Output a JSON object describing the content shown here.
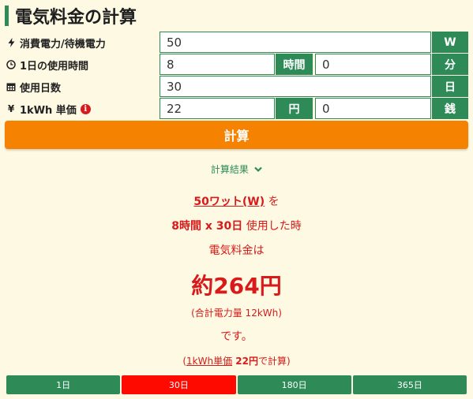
{
  "title": "電気料金の計算",
  "form": {
    "power": {
      "icon": "bolt-icon",
      "label": "消費電力/待機電力",
      "value": "50",
      "unit": "W"
    },
    "hours": {
      "icon": "clock-icon",
      "label": "1日の使用時間",
      "hours_value": "8",
      "hours_unit": "時間",
      "minutes_value": "0",
      "minutes_unit": "分"
    },
    "days": {
      "icon": "calendar-icon",
      "label": "使用日数",
      "value": "30",
      "unit": "日"
    },
    "price": {
      "icon": "yen-icon",
      "label": "1kWh 単価",
      "info": "i",
      "yen_value": "22",
      "yen_unit": "円",
      "sen_value": "0",
      "sen_unit": "銭"
    }
  },
  "calc_button": "計算",
  "result": {
    "heading": "計算結果",
    "watt_text": "50ワット(W)",
    "wo": " を",
    "hours_text": "8時間 x 30日",
    "used": " 使用した時",
    "cost_label": "電気料金は",
    "cost_value": "約264円",
    "total": "(合計電力量 12kWh)",
    "desu": "です。",
    "paren_open": "(",
    "unit_price_label": "1kWh単価",
    "unit_price_value": " 22円",
    "calc_suffix": "で計算)"
  },
  "tabs": [
    {
      "label": "1日",
      "active": false
    },
    {
      "label": "30日",
      "active": true
    },
    {
      "label": "180日",
      "active": false
    },
    {
      "label": "365日",
      "active": false
    }
  ],
  "colors": {
    "green": "#2e8b57",
    "orange": "#f58200",
    "red": "#d81a1a",
    "background": "#fdf9e3"
  }
}
